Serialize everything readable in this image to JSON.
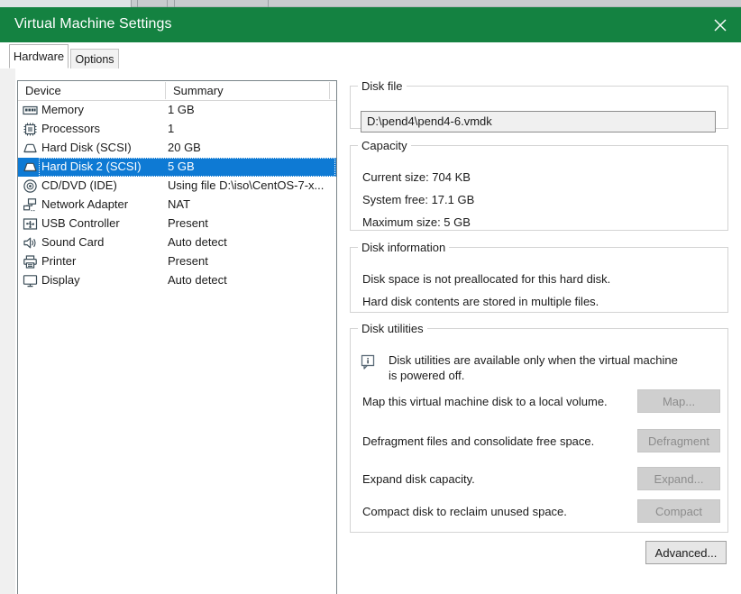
{
  "window": {
    "title": "Virtual Machine Settings",
    "close_icon": "close-icon",
    "titlebar_color": "#148241"
  },
  "tabs": [
    {
      "label": "Hardware",
      "active": true
    },
    {
      "label": "Options",
      "active": false
    }
  ],
  "device_list": {
    "columns": [
      "Device",
      "Summary"
    ],
    "selection_color": "#0e7ad4",
    "rows": [
      {
        "icon": "memory-icon",
        "device": "Memory",
        "summary": "1 GB",
        "selected": false
      },
      {
        "icon": "processor-icon",
        "device": "Processors",
        "summary": "1",
        "selected": false
      },
      {
        "icon": "hard-disk-icon",
        "device": "Hard Disk (SCSI)",
        "summary": "20 GB",
        "selected": false
      },
      {
        "icon": "hard-disk-icon",
        "device": "Hard Disk 2 (SCSI)",
        "summary": "5 GB",
        "selected": true
      },
      {
        "icon": "cd-dvd-icon",
        "device": "CD/DVD (IDE)",
        "summary": "Using file D:\\iso\\CentOS-7-x...",
        "selected": false
      },
      {
        "icon": "network-adapter-icon",
        "device": "Network Adapter",
        "summary": "NAT",
        "selected": false
      },
      {
        "icon": "usb-controller-icon",
        "device": "USB Controller",
        "summary": "Present",
        "selected": false
      },
      {
        "icon": "sound-card-icon",
        "device": "Sound Card",
        "summary": "Auto detect",
        "selected": false
      },
      {
        "icon": "printer-icon",
        "device": "Printer",
        "summary": "Present",
        "selected": false
      },
      {
        "icon": "display-icon",
        "device": "Display",
        "summary": "Auto detect",
        "selected": false
      }
    ]
  },
  "disk_file": {
    "legend": "Disk file",
    "value": "D:\\pend4\\pend4-6.vmdk"
  },
  "capacity": {
    "legend": "Capacity",
    "current_size": "Current size: 704 KB",
    "system_free": "System free: 17.1 GB",
    "maximum_size": "Maximum size: 5 GB"
  },
  "disk_information": {
    "legend": "Disk information",
    "line1": "Disk space is not preallocated for this hard disk.",
    "line2": "Hard disk contents are stored in multiple files."
  },
  "disk_utilities": {
    "legend": "Disk utilities",
    "note_icon": "info-icon",
    "note": "Disk utilities are available only when the virtual machine is powered off.",
    "rows": [
      {
        "text": "Map this virtual machine disk to a local volume.",
        "button": "Map...",
        "enabled": false
      },
      {
        "text": "Defragment files and consolidate free space.",
        "button": "Defragment",
        "enabled": false
      },
      {
        "text": "Expand disk capacity.",
        "button": "Expand...",
        "enabled": false
      },
      {
        "text": "Compact disk to reclaim unused space.",
        "button": "Compact",
        "enabled": false
      }
    ]
  },
  "advanced_button": {
    "label": "Advanced..."
  }
}
